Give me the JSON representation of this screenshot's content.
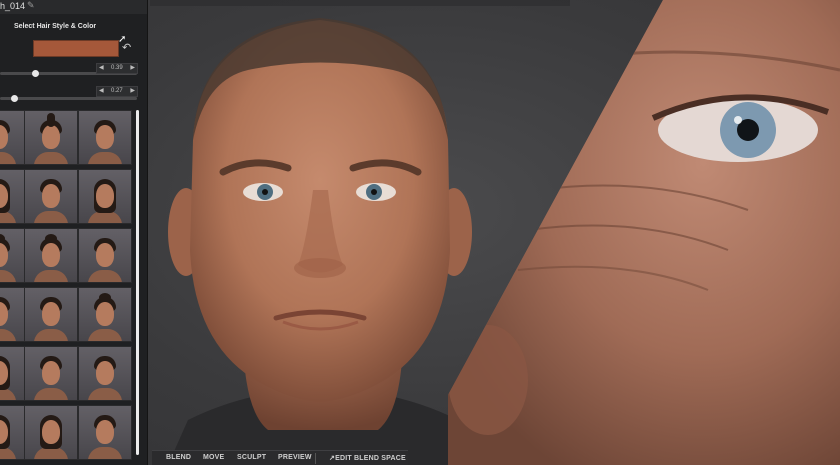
{
  "panel": {
    "preset_name": "h_014",
    "section_label": "Select Hair Style & Color",
    "swatch_color": "#a5583a",
    "slider1_value": "0.39",
    "slider2_value": "0.27",
    "slider1_level": 0.23,
    "slider2_level": 0.08
  },
  "hair_presets": [
    {
      "hair": "short"
    },
    {
      "hair": "mohawk"
    },
    {
      "hair": "short"
    },
    {
      "hair": "long"
    },
    {
      "hair": "short"
    },
    {
      "hair": "long"
    },
    {
      "hair": "bun"
    },
    {
      "hair": "bun"
    },
    {
      "hair": "short"
    },
    {
      "hair": "short"
    },
    {
      "hair": "short"
    },
    {
      "hair": "bun"
    },
    {
      "hair": "long"
    },
    {
      "hair": "short"
    },
    {
      "hair": "short"
    },
    {
      "hair": "long"
    },
    {
      "hair": "long"
    },
    {
      "hair": "short"
    }
  ],
  "toolbar": {
    "blend": "BLEND",
    "move": "MOVE",
    "sculpt": "SCULPT",
    "preview": "PREVIEW",
    "edit_blend_space": "EDIT BLEND SPACE"
  }
}
